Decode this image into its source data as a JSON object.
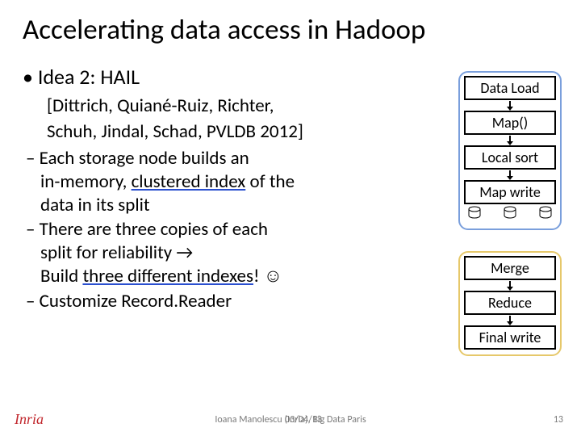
{
  "title": "Accelerating data access in Hadoop",
  "bullet": "Idea 2: HAIL",
  "citation_l1": "[Dittrich, Quiané-Ruiz, Richter,",
  "citation_l2": "Schuh, Jindal, Schad, PVLDB 2012]",
  "d1_l1": "Each storage node builds an",
  "d1_l2_pre": "in-memory, ",
  "d1_l2_u": "clustered index",
  "d1_l2_post": " of the",
  "d1_l3": "data in its split",
  "d2_l1": "There are three copies of each",
  "d2_l2": "split for reliability →",
  "d2_l3_pre": "Build ",
  "d2_l3_u": "three different indexes",
  "d2_l3_post": "! ☺",
  "d3": "Customize Record.Reader",
  "stages": {
    "s1": "Data Load",
    "s2": "Map()",
    "s3": "Local sort",
    "s4": "Map write",
    "s5": "Merge",
    "s6": "Reduce",
    "s7": "Final write"
  },
  "footer": {
    "logo": "Inria",
    "date": "03/04/13",
    "center": "Ioana Manolescu (Inria), Big Data Paris",
    "page": "13"
  }
}
